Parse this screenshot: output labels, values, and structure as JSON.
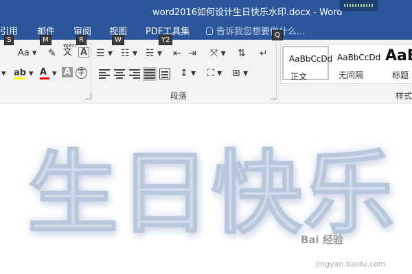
{
  "window": {
    "title": "word2016如何设计生日快乐水印.docx - Word"
  },
  "tabs": [
    "引用",
    "邮件",
    "审阅",
    "视图",
    "PDF工具集"
  ],
  "tell_me": {
    "placeholder": "告诉我您想要做什么..."
  },
  "keytips": {
    "references": "S",
    "mailings": "M",
    "review": "R",
    "view": "W",
    "pdf": "Y2",
    "tellme": "Q"
  },
  "ribbon": {
    "font_buttons": {
      "change_case": "Aa",
      "phonetic_top": "wén",
      "phonetic_char": "文",
      "text_effect": "A",
      "char_shading": "A",
      "enclose_char": "字"
    },
    "paragraph_group_label": "段落",
    "styles_group_label": "样式",
    "styles": [
      {
        "preview": "AaBbCcDd",
        "name": "正文"
      },
      {
        "preview": "AaBbCcDd",
        "name": "无间隔"
      },
      {
        "preview": "AaB",
        "name": "标题"
      }
    ]
  },
  "document": {
    "watermark_text": "生日快乐",
    "site_badge": "Bai 经验",
    "site_url": "jingyan.baidu.com"
  },
  "colors": {
    "accent": "#2b579a",
    "ribbon_bg": "#f3f3f3",
    "highlight": "#ffff00",
    "font_color": "#ff0000"
  }
}
